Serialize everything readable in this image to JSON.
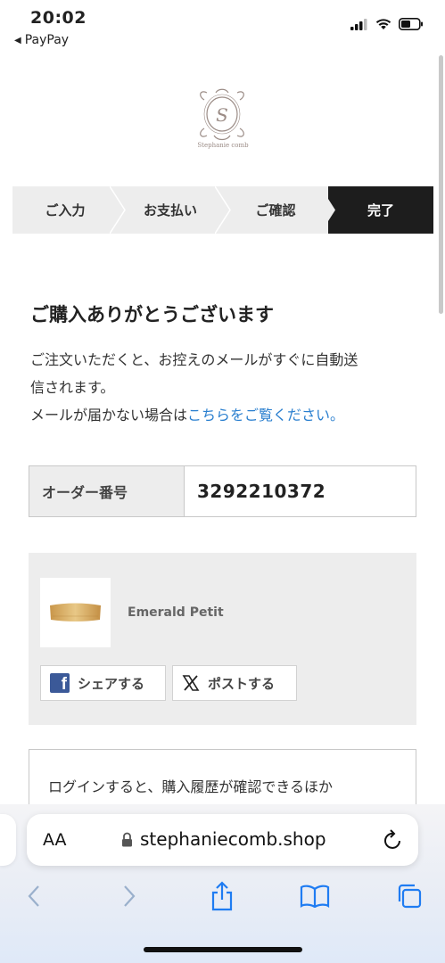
{
  "status_bar": {
    "time": "20:02",
    "back_label": "PayPay"
  },
  "logo": {
    "brand_text": "Stephanie comb"
  },
  "steps": [
    {
      "label": "ご入力"
    },
    {
      "label": "お支払い"
    },
    {
      "label": "ご確認"
    },
    {
      "label": "完了",
      "active": true
    }
  ],
  "thanks": {
    "title": "ご購入ありがとうございます",
    "line1": "ご注文いただくと、お控えのメールがすぐに自動送",
    "line2": "信されます。",
    "line3_prefix": "メールが届かない場合は",
    "line3_link": "こちらをご覧ください。"
  },
  "order": {
    "label": "オーダー番号",
    "value": "3292210372"
  },
  "product": {
    "name": "Emerald Petit"
  },
  "share": {
    "facebook_label": "シェアする",
    "x_label": "ポストする"
  },
  "login": {
    "text": "ログインすると、購入履歴が確認できるほか"
  },
  "browser": {
    "aa_label": "AA",
    "url": "stephaniecomb.shop"
  },
  "colors": {
    "link": "#2a7fcf",
    "active_step": "#1d1d1d",
    "facebook": "#3b5998",
    "ios_blue": "#1f7cf2"
  }
}
